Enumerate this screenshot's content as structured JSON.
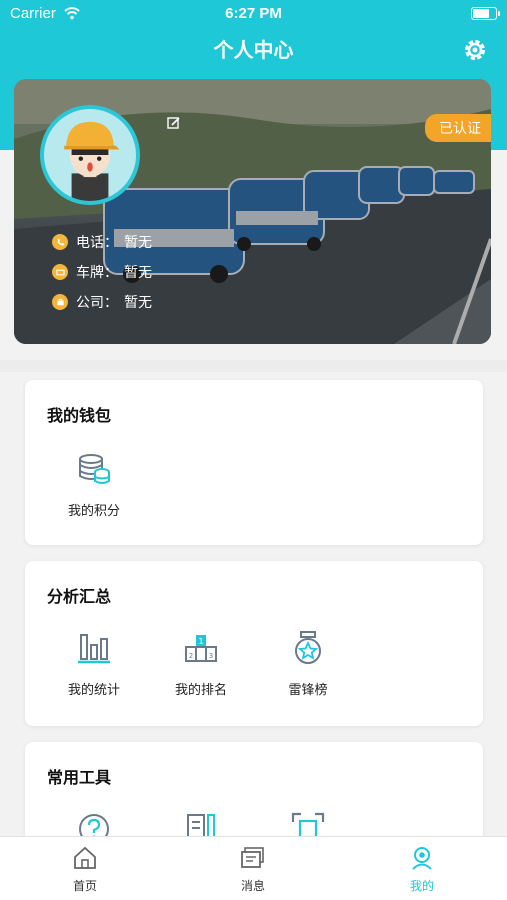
{
  "status_bar": {
    "carrier": "Carrier",
    "time": "6:27 PM"
  },
  "header": {
    "title": "个人中心"
  },
  "profile": {
    "verified_badge": "已认证",
    "phone_label": "电话：",
    "phone_value": "暂无",
    "plate_label": "车牌：",
    "plate_value": "暂无",
    "company_label": "公司：",
    "company_value": "暂无"
  },
  "wallet": {
    "title": "我的钱包",
    "items": [
      {
        "label": "我的积分",
        "icon": "database-coins-icon"
      }
    ]
  },
  "analysis": {
    "title": "分析汇总",
    "items": [
      {
        "label": "我的统计",
        "icon": "bar-chart-icon"
      },
      {
        "label": "我的排名",
        "icon": "podium-icon"
      },
      {
        "label": "雷锋榜",
        "icon": "medal-icon"
      }
    ]
  },
  "tools": {
    "title": "常用工具",
    "items": [
      {
        "icon": "help-icon"
      },
      {
        "icon": "document-edit-icon"
      },
      {
        "icon": "scan-icon"
      }
    ]
  },
  "tabbar": {
    "tabs": [
      {
        "label": "首页",
        "icon": "home-icon"
      },
      {
        "label": "消息",
        "icon": "message-icon"
      },
      {
        "label": "我的",
        "icon": "profile-icon",
        "active": true
      }
    ]
  },
  "colors": {
    "accent": "#1fc8d6",
    "badge": "#f3a52a",
    "info_dot": "#f4b53a",
    "icon_stroke": "#6b7a8a"
  }
}
